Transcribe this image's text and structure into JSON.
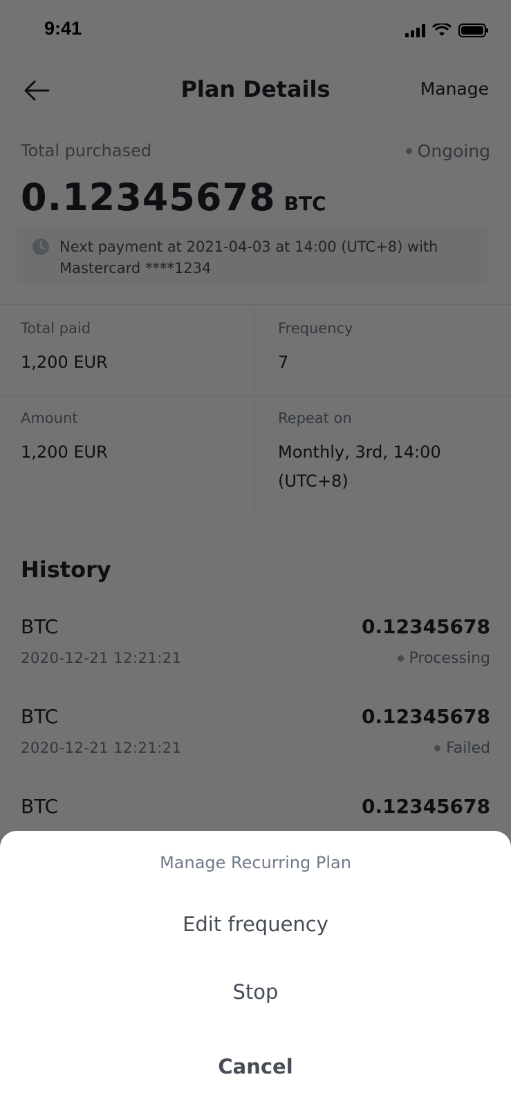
{
  "status_bar": {
    "time": "9:41"
  },
  "nav": {
    "title": "Plan Details",
    "manage_label": "Manage"
  },
  "summary": {
    "total_label": "Total purchased",
    "status": "Ongoing",
    "total_amount": "0.12345678",
    "unit": "BTC",
    "notice_line1": "Next payment at 2021-04-03 at 14:00 (UTC+8) with",
    "notice_line2": "Mastercard ****1234"
  },
  "info": {
    "total_paid_label": "Total paid",
    "total_paid_value": "1,200 EUR",
    "frequency_label": "Frequency",
    "frequency_value": "7",
    "amount_label": "Amount",
    "amount_value": "1,200 EUR",
    "repeat_label": "Repeat on",
    "repeat_value_line1": "Monthly, 3rd, 14:00",
    "repeat_value_line2": "(UTC+8)"
  },
  "history": {
    "title": "History",
    "items": [
      {
        "coin": "BTC",
        "amount": "0.12345678",
        "date": "2020-12-21 12:21:21",
        "status": "Processing"
      },
      {
        "coin": "BTC",
        "amount": "0.12345678",
        "date": "2020-12-21 12:21:21",
        "status": "Failed"
      },
      {
        "coin": "BTC",
        "amount": "0.12345678"
      }
    ]
  },
  "sheet": {
    "title": "Manage Recurring Plan",
    "edit_label": "Edit frequency",
    "stop_label": "Stop",
    "cancel_label": "Cancel"
  }
}
